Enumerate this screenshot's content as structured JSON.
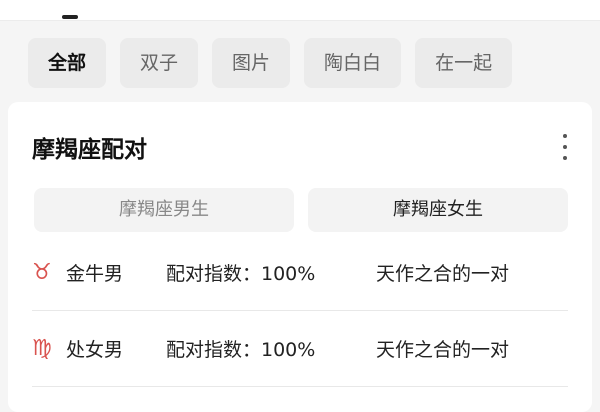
{
  "tabs": [
    {
      "label": "全部"
    },
    {
      "label": "双子"
    },
    {
      "label": "图片"
    },
    {
      "label": "陶白白"
    },
    {
      "label": "在一起"
    }
  ],
  "card": {
    "title": "摩羯座配对",
    "segments": [
      {
        "label": "摩羯座男生"
      },
      {
        "label": "摩羯座女生"
      }
    ],
    "rows": [
      {
        "sign": "♉",
        "sign_icon": "taurus-icon",
        "who": "金牛男",
        "index": "配对指数：100%",
        "desc": "天作之合的一对"
      },
      {
        "sign": "♍",
        "sign_icon": "virgo-icon",
        "who": "处女男",
        "index": "配对指数：100%",
        "desc": "天作之合的一对"
      }
    ]
  },
  "colors": {
    "accent": "#d9534f",
    "background": "#f5f5f5",
    "card": "#ffffff"
  }
}
